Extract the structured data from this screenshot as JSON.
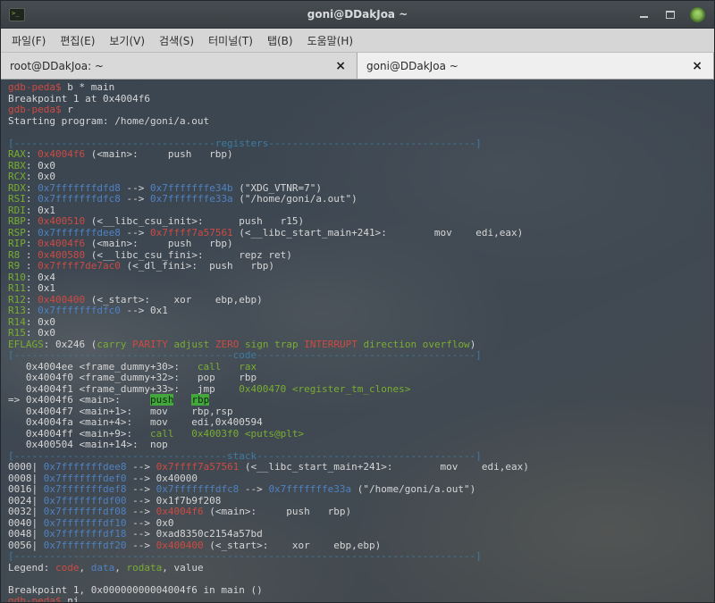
{
  "window": {
    "title": "goni@DDakJoa ~"
  },
  "menubar": {
    "items": [
      {
        "label": "파일(F)"
      },
      {
        "label": "편집(E)"
      },
      {
        "label": "보기(V)"
      },
      {
        "label": "검색(S)"
      },
      {
        "label": "터미널(T)"
      },
      {
        "label": "탭(B)"
      },
      {
        "label": "도움말(H)"
      }
    ]
  },
  "tabs": [
    {
      "label": "root@DDakJoa: ~",
      "close": "×"
    },
    {
      "label": "goni@DDakJoa ~",
      "close": "×"
    }
  ],
  "colors": {
    "red": "#cd4a42",
    "green": "#79ad31",
    "blue": "#4f82c2",
    "separator": "#3d7ca0",
    "foreground": "#d6d6d6",
    "highlight_bg": "#44a73e"
  },
  "terminal": {
    "lines": [
      {
        "segs": [
          [
            "r",
            "gdb-peda$ "
          ],
          [
            "w",
            "b * main"
          ]
        ]
      },
      {
        "segs": [
          [
            "w",
            "Breakpoint 1 at 0x4004f6"
          ]
        ]
      },
      {
        "segs": [
          [
            "r",
            "gdb-peda$ "
          ],
          [
            "w",
            "r"
          ]
        ]
      },
      {
        "segs": [
          [
            "w",
            "Starting program: /home/goni/a.out"
          ]
        ]
      },
      {
        "segs": []
      },
      {
        "segs": [
          [
            "s",
            "[----------------------------------registers-----------------------------------]"
          ]
        ]
      },
      {
        "segs": [
          [
            "g",
            "RAX"
          ],
          [
            "w",
            ": "
          ],
          [
            "r",
            "0x4004f6"
          ],
          [
            "w",
            " (<main>:     push   rbp)"
          ]
        ]
      },
      {
        "segs": [
          [
            "g",
            "RBX"
          ],
          [
            "w",
            ": 0x0"
          ]
        ]
      },
      {
        "segs": [
          [
            "g",
            "RCX"
          ],
          [
            "w",
            ": 0x0"
          ]
        ]
      },
      {
        "segs": [
          [
            "g",
            "RDX"
          ],
          [
            "w",
            ": "
          ],
          [
            "b",
            "0x7fffffffdfd8"
          ],
          [
            "w",
            " --> "
          ],
          [
            "b",
            "0x7fffffffe34b"
          ],
          [
            "w",
            " (\"XDG_VTNR=7\")"
          ]
        ]
      },
      {
        "segs": [
          [
            "g",
            "RSI"
          ],
          [
            "w",
            ": "
          ],
          [
            "b",
            "0x7fffffffdfc8"
          ],
          [
            "w",
            " --> "
          ],
          [
            "b",
            "0x7fffffffe33a"
          ],
          [
            "w",
            " (\"/home/goni/a.out\")"
          ]
        ]
      },
      {
        "segs": [
          [
            "g",
            "RDI"
          ],
          [
            "w",
            ": 0x1"
          ]
        ]
      },
      {
        "segs": [
          [
            "g",
            "RBP"
          ],
          [
            "w",
            ": "
          ],
          [
            "r",
            "0x400510"
          ],
          [
            "w",
            " (<__libc_csu_init>:      push   r15)"
          ]
        ]
      },
      {
        "segs": [
          [
            "g",
            "RSP"
          ],
          [
            "w",
            ": "
          ],
          [
            "b",
            "0x7fffffffdee8"
          ],
          [
            "w",
            " --> "
          ],
          [
            "r",
            "0x7ffff7a57561"
          ],
          [
            "w",
            " (<__libc_start_main+241>:        mov    edi,eax)"
          ]
        ]
      },
      {
        "segs": [
          [
            "g",
            "RIP"
          ],
          [
            "w",
            ": "
          ],
          [
            "r",
            "0x4004f6"
          ],
          [
            "w",
            " (<main>:     push   rbp)"
          ]
        ]
      },
      {
        "segs": [
          [
            "g",
            "R8 "
          ],
          [
            "w",
            ": "
          ],
          [
            "r",
            "0x400580"
          ],
          [
            "w",
            " (<__libc_csu_fini>:      repz ret)"
          ]
        ]
      },
      {
        "segs": [
          [
            "g",
            "R9 "
          ],
          [
            "w",
            ": "
          ],
          [
            "r",
            "0x7ffff7de7ac0"
          ],
          [
            "w",
            " (<_dl_fini>:  push   rbp)"
          ]
        ]
      },
      {
        "segs": [
          [
            "g",
            "R10"
          ],
          [
            "w",
            ": 0x4"
          ]
        ]
      },
      {
        "segs": [
          [
            "g",
            "R11"
          ],
          [
            "w",
            ": 0x1"
          ]
        ]
      },
      {
        "segs": [
          [
            "g",
            "R12"
          ],
          [
            "w",
            ": "
          ],
          [
            "r",
            "0x400400"
          ],
          [
            "w",
            " (<_start>:    xor    ebp,ebp)"
          ]
        ]
      },
      {
        "segs": [
          [
            "g",
            "R13"
          ],
          [
            "w",
            ": "
          ],
          [
            "b",
            "0x7fffffffdfc0"
          ],
          [
            "w",
            " --> 0x1"
          ]
        ]
      },
      {
        "segs": [
          [
            "g",
            "R14"
          ],
          [
            "w",
            ": 0x0"
          ]
        ]
      },
      {
        "segs": [
          [
            "g",
            "R15"
          ],
          [
            "w",
            ": 0x0"
          ]
        ]
      },
      {
        "segs": [
          [
            "g",
            "EFLAGS"
          ],
          [
            "w",
            ": 0x246 ("
          ],
          [
            "g",
            "carry"
          ],
          [
            "w",
            " "
          ],
          [
            "r",
            "PARITY"
          ],
          [
            "w",
            " "
          ],
          [
            "g",
            "adjust"
          ],
          [
            "w",
            " "
          ],
          [
            "r",
            "ZERO"
          ],
          [
            "w",
            " "
          ],
          [
            "g",
            "sign"
          ],
          [
            "w",
            " "
          ],
          [
            "g",
            "trap"
          ],
          [
            "w",
            " "
          ],
          [
            "r",
            "INTERRUPT"
          ],
          [
            "w",
            " "
          ],
          [
            "g",
            "direction"
          ],
          [
            "w",
            " "
          ],
          [
            "g",
            "overflow"
          ],
          [
            "w",
            ")"
          ]
        ]
      },
      {
        "segs": [
          [
            "s",
            "[-------------------------------------code-------------------------------------]"
          ]
        ]
      },
      {
        "segs": [
          [
            "w",
            "   0x4004ee <frame_dummy+30>:   "
          ],
          [
            "g",
            "call   rax"
          ]
        ]
      },
      {
        "segs": [
          [
            "w",
            "   0x4004f0 <frame_dummy+32>:   pop    rbp"
          ]
        ]
      },
      {
        "segs": [
          [
            "w",
            "   0x4004f1 <frame_dummy+33>:   jmp    "
          ],
          [
            "g",
            "0x400470 <register_tm_clones>"
          ]
        ]
      },
      {
        "segs": [
          [
            "w",
            "=> 0x4004f6 <main>:     "
          ],
          [
            "h",
            "push"
          ],
          [
            "w",
            "   "
          ],
          [
            "h",
            "rbp"
          ]
        ]
      },
      {
        "segs": [
          [
            "w",
            "   0x4004f7 <main+1>:   mov    rbp,rsp"
          ]
        ]
      },
      {
        "segs": [
          [
            "w",
            "   0x4004fa <main+4>:   mov    edi,0x400594"
          ]
        ]
      },
      {
        "segs": [
          [
            "w",
            "   0x4004ff <main+9>:   "
          ],
          [
            "g",
            "call   0x4003f0 <puts@plt>"
          ]
        ]
      },
      {
        "segs": [
          [
            "w",
            "   0x400504 <main+14>:  nop"
          ]
        ]
      },
      {
        "segs": [
          [
            "s",
            "[------------------------------------stack-------------------------------------]"
          ]
        ]
      },
      {
        "segs": [
          [
            "w",
            "0000| "
          ],
          [
            "b",
            "0x7fffffffdee8"
          ],
          [
            "w",
            " --> "
          ],
          [
            "r",
            "0x7ffff7a57561"
          ],
          [
            "w",
            " (<__libc_start_main+241>:        mov    edi,eax)"
          ]
        ]
      },
      {
        "segs": [
          [
            "w",
            "0008| "
          ],
          [
            "b",
            "0x7fffffffdef0"
          ],
          [
            "w",
            " --> 0x40000"
          ]
        ]
      },
      {
        "segs": [
          [
            "w",
            "0016| "
          ],
          [
            "b",
            "0x7fffffffdef8"
          ],
          [
            "w",
            " --> "
          ],
          [
            "b",
            "0x7fffffffdfc8"
          ],
          [
            "w",
            " --> "
          ],
          [
            "b",
            "0x7fffffffe33a"
          ],
          [
            "w",
            " (\"/home/goni/a.out\")"
          ]
        ]
      },
      {
        "segs": [
          [
            "w",
            "0024| "
          ],
          [
            "b",
            "0x7fffffffdf00"
          ],
          [
            "w",
            " --> 0x1f7b9f208"
          ]
        ]
      },
      {
        "segs": [
          [
            "w",
            "0032| "
          ],
          [
            "b",
            "0x7fffffffdf08"
          ],
          [
            "w",
            " --> "
          ],
          [
            "r",
            "0x4004f6"
          ],
          [
            "w",
            " (<main>:     push   rbp)"
          ]
        ]
      },
      {
        "segs": [
          [
            "w",
            "0040| "
          ],
          [
            "b",
            "0x7fffffffdf10"
          ],
          [
            "w",
            " --> 0x0"
          ]
        ]
      },
      {
        "segs": [
          [
            "w",
            "0048| "
          ],
          [
            "b",
            "0x7fffffffdf18"
          ],
          [
            "w",
            " --> 0xad8350c2154a57bd"
          ]
        ]
      },
      {
        "segs": [
          [
            "w",
            "0056| "
          ],
          [
            "b",
            "0x7fffffffdf20"
          ],
          [
            "w",
            " --> "
          ],
          [
            "r",
            "0x400400"
          ],
          [
            "w",
            " (<_start>:    xor    ebp,ebp)"
          ]
        ]
      },
      {
        "segs": [
          [
            "s",
            "[------------------------------------------------------------------------------]"
          ]
        ]
      },
      {
        "segs": [
          [
            "w",
            "Legend: "
          ],
          [
            "r",
            "code"
          ],
          [
            "w",
            ", "
          ],
          [
            "b",
            "data"
          ],
          [
            "w",
            ", "
          ],
          [
            "g",
            "rodata"
          ],
          [
            "w",
            ", value"
          ]
        ]
      },
      {
        "segs": []
      },
      {
        "segs": [
          [
            "w",
            "Breakpoint 1, 0x00000000004004f6 in main ()"
          ]
        ]
      },
      {
        "segs": [
          [
            "r",
            "gdb-peda$ "
          ],
          [
            "w",
            "ni"
          ]
        ]
      }
    ]
  }
}
